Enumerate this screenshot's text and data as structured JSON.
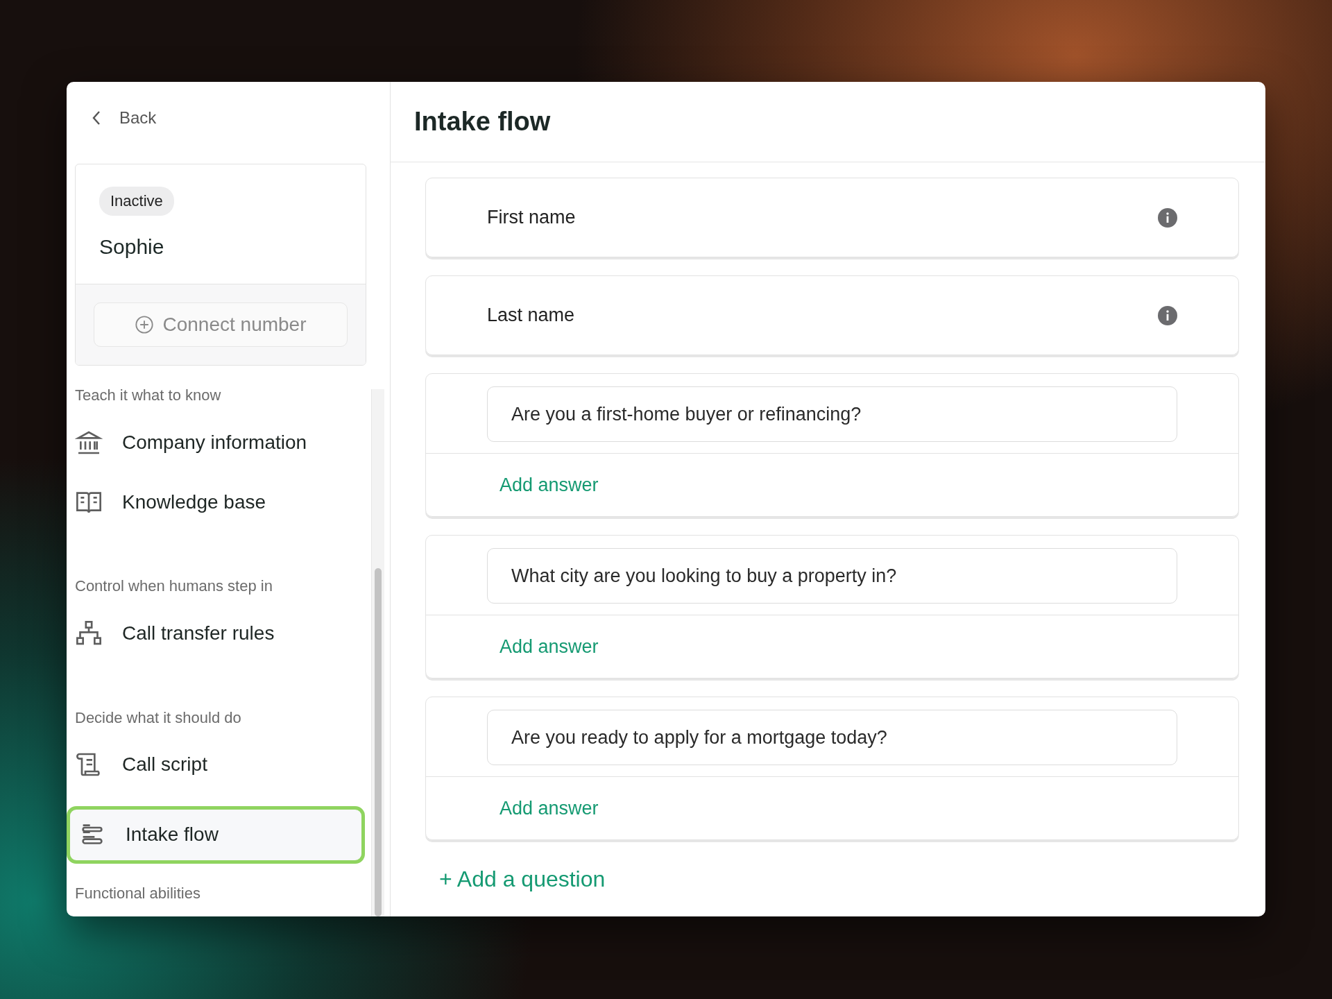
{
  "back": {
    "label": "Back"
  },
  "agent": {
    "status": "Inactive",
    "name": "Sophie",
    "connect_button": "Connect number"
  },
  "sidebar": {
    "sections": [
      {
        "label": "Teach it what to know",
        "items": [
          {
            "label": "Company information",
            "kind": "bank",
            "selected": false
          },
          {
            "label": "Knowledge base",
            "kind": "book",
            "selected": false
          }
        ]
      },
      {
        "label": "Control when humans step in",
        "items": [
          {
            "label": "Call transfer rules",
            "kind": "tree",
            "selected": false
          }
        ]
      },
      {
        "label": "Decide what it should do",
        "items": [
          {
            "label": "Call script",
            "kind": "scroll",
            "selected": false
          },
          {
            "label": "Intake flow",
            "kind": "flow",
            "selected": true
          }
        ]
      },
      {
        "label": "Functional abilities"
      }
    ]
  },
  "page": {
    "title": "Intake flow"
  },
  "questions": [
    {
      "kind": "fixed",
      "label": "First name"
    },
    {
      "kind": "fixed",
      "label": "Last name"
    },
    {
      "kind": "custom",
      "value": "Are you a first-home buyer or refinancing?",
      "add_answer": "Add answer"
    },
    {
      "kind": "custom",
      "value": "What city are you looking to buy a property in?",
      "add_answer": "Add answer"
    },
    {
      "kind": "custom",
      "value": "Are you ready to apply for a mortgage today?",
      "add_answer": "Add answer"
    }
  ],
  "add_question": "+ Add a question"
}
